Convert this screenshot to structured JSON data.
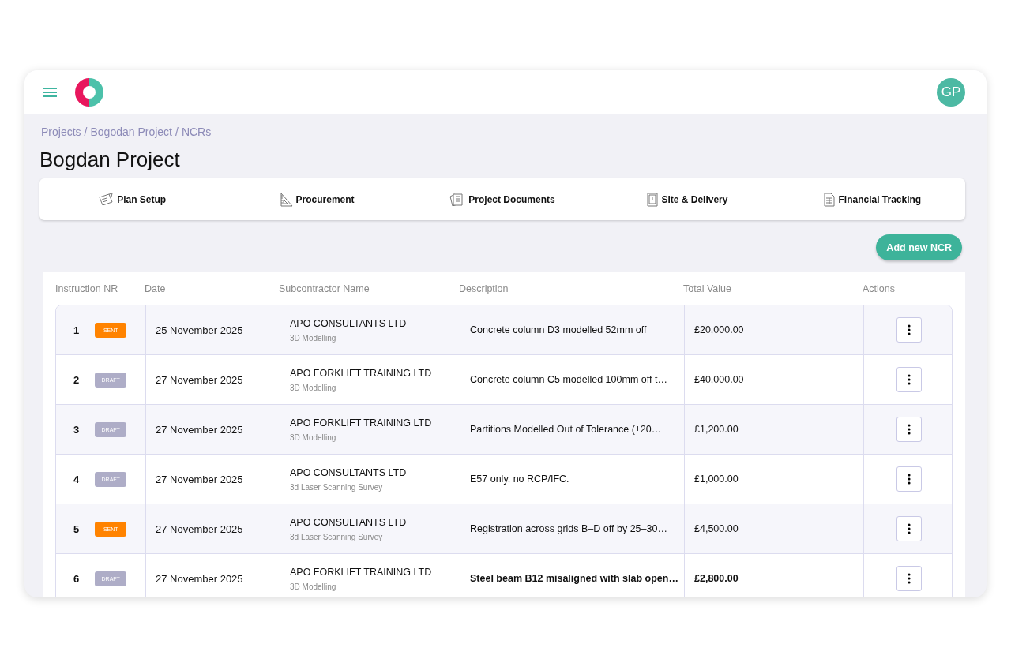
{
  "header": {
    "avatar": "GP"
  },
  "breadcrumb": {
    "separator": "/",
    "items": [
      {
        "label": "Projects",
        "kind": "link"
      },
      {
        "label": "Bogodan Project",
        "kind": "link"
      },
      {
        "label": "NCRs",
        "kind": "current"
      }
    ]
  },
  "page_title": "Bogdan Project",
  "nav": [
    {
      "label": "Plan Setup",
      "kind": "setup"
    },
    {
      "label": "Procurement",
      "kind": "ruler"
    },
    {
      "label": "Project Documents",
      "kind": "docs"
    },
    {
      "label": "Site & Delivery",
      "kind": "site"
    },
    {
      "label": "Financial Tracking",
      "kind": "finance"
    }
  ],
  "add_button": "Add new NCR",
  "table": {
    "columns": [
      "Instruction NR",
      "Date",
      "Subcontractor Name",
      "Description",
      "Total Value",
      "Actions"
    ],
    "rows": [
      {
        "nr": "1",
        "status": {
          "kind": "sent",
          "label": "SENT"
        },
        "date": "25 November 2025",
        "subcontractor": "APO CONSULTANTS LTD",
        "trade": "3D Modelling",
        "description": "Concrete column D3 modelled 52mm off",
        "value": "£20,000.00",
        "bold": false
      },
      {
        "nr": "2",
        "status": {
          "kind": "draft",
          "label": "DRAFT"
        },
        "date": "27 November 2025",
        "subcontractor": "APO FORKLIFT TRAINING LTD",
        "trade": "3D Modelling",
        "description": "Concrete column C5 modelled 100mm off t…",
        "value": "£40,000.00",
        "bold": false
      },
      {
        "nr": "3",
        "status": {
          "kind": "draft",
          "label": "DRAFT"
        },
        "date": "27 November 2025",
        "subcontractor": "APO FORKLIFT TRAINING LTD",
        "trade": "3D Modelling",
        "description": "Partitions Modelled Out of Tolerance (±20…",
        "value": "£1,200.00",
        "bold": false
      },
      {
        "nr": "4",
        "status": {
          "kind": "draft",
          "label": "DRAFT"
        },
        "date": "27 November 2025",
        "subcontractor": "APO CONSULTANTS LTD",
        "trade": "3d Laser Scanning Survey",
        "description": "E57 only, no RCP/IFC.",
        "value": "£1,000.00",
        "bold": false
      },
      {
        "nr": "5",
        "status": {
          "kind": "sent",
          "label": "SENT"
        },
        "date": "27 November 2025",
        "subcontractor": "APO CONSULTANTS LTD",
        "trade": "3d Laser Scanning Survey",
        "description": "Registration across grids B–D off by 25–30…",
        "value": "£4,500.00",
        "bold": false
      },
      {
        "nr": "6",
        "status": {
          "kind": "draft",
          "label": "DRAFT"
        },
        "date": "27 November 2025",
        "subcontractor": "APO FORKLIFT TRAINING LTD",
        "trade": "3D Modelling",
        "description": "Steel beam B12 misaligned with slab open…",
        "value": "£2,800.00",
        "bold": true
      }
    ]
  }
}
